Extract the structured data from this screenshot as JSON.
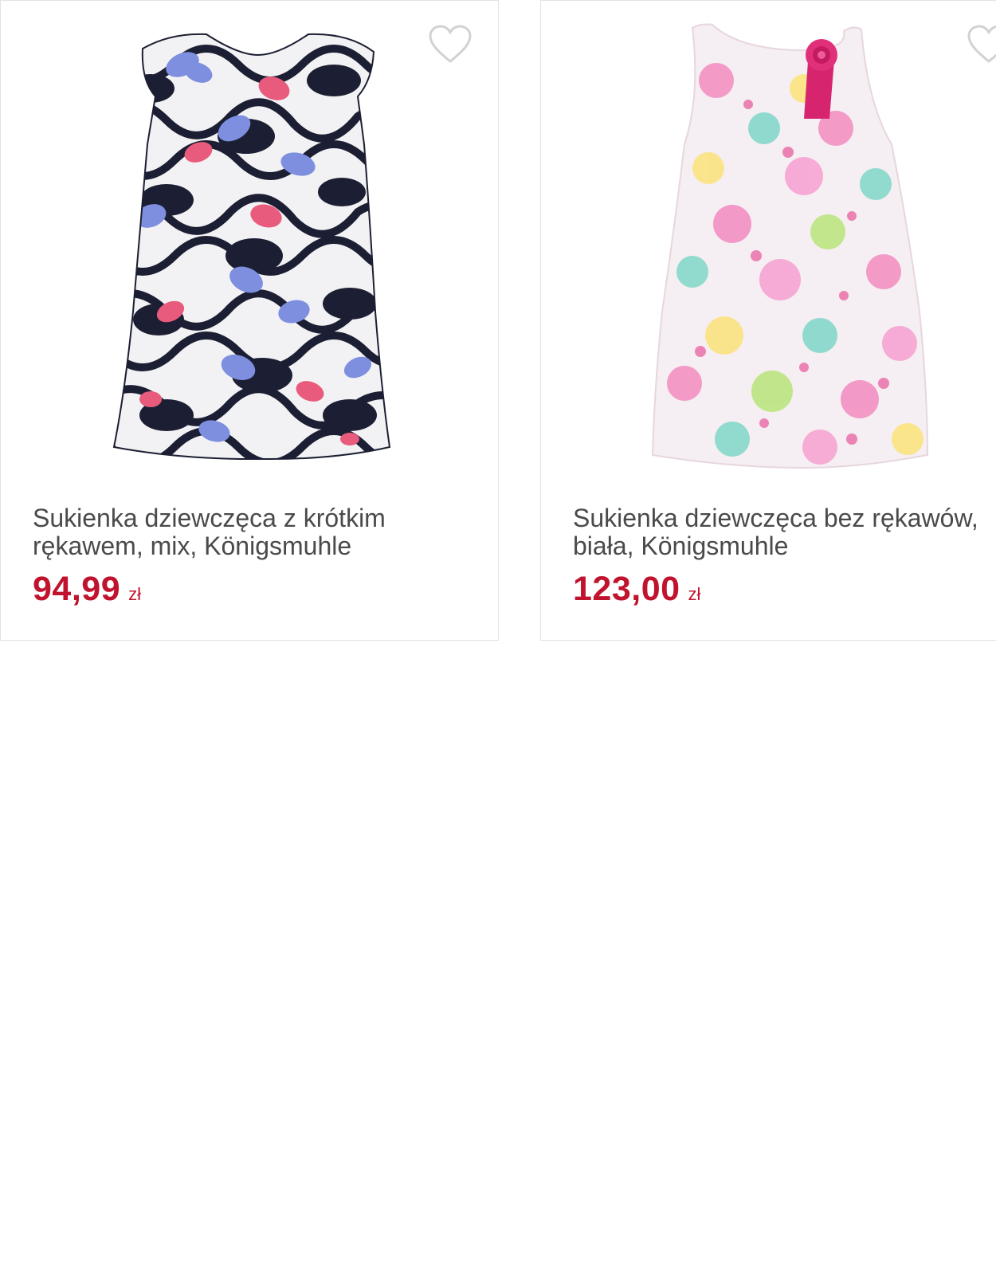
{
  "products": [
    {
      "title_line1": "Sukienka dziewczęca z krótkim",
      "title_line2": "rękawem, mix, Königsmuhle",
      "price": "94,99",
      "currency": "zł"
    },
    {
      "title_line1": "Sukienka dziewczęca bez rękawów,",
      "title_line2": "biała, Königsmuhle",
      "price": "123,00",
      "currency": "zł"
    }
  ],
  "colors": {
    "price": "#c0142e",
    "title": "#4a4a4a",
    "border": "#e2e2e2",
    "heart_outline": "#d2d2d2"
  },
  "icons": {
    "favorite": "heart-outline-icon"
  }
}
